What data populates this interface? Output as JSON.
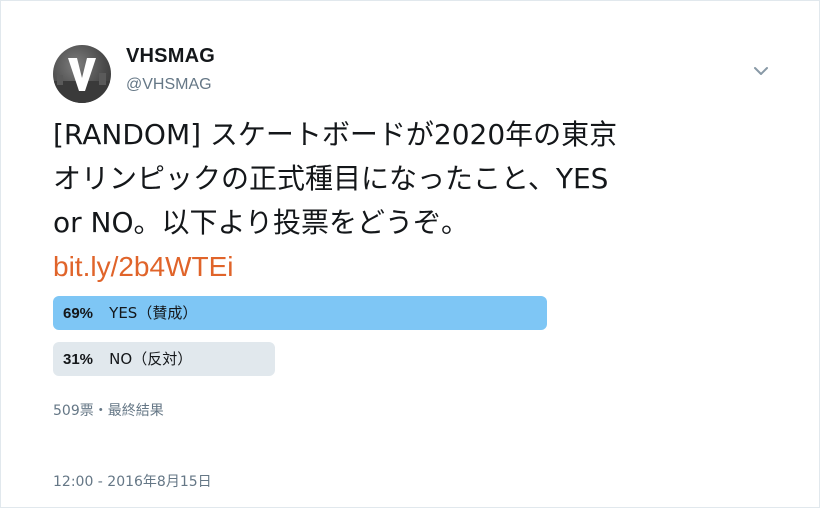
{
  "user": {
    "display_name": "VHSMAG",
    "handle": "@VHSMAG",
    "avatar_letter": "V"
  },
  "menu": {
    "icon": "chevron-down-icon"
  },
  "tweet": {
    "text_lines": [
      "[RANDOM] スケートボードが2020年の東京",
      "オリンピックの正式種目になったこと、YES",
      "or NO。以下より投票をどうぞ。"
    ],
    "link": "bit.ly/2b4WTEi"
  },
  "poll": {
    "options": [
      {
        "percent_label": "69%",
        "percent": 69,
        "label": "YES（賛成）",
        "winner": true
      },
      {
        "percent_label": "31%",
        "percent": 31,
        "label": "NO（反対）",
        "winner": false
      }
    ],
    "summary": "509票・最終結果"
  },
  "timestamp": "12:00 - 2016年8月15日",
  "colors": {
    "winner_bar": "#7ec6f5",
    "loser_bar": "#e1e8ed",
    "link": "#e0642a",
    "secondary_text": "#657786"
  }
}
